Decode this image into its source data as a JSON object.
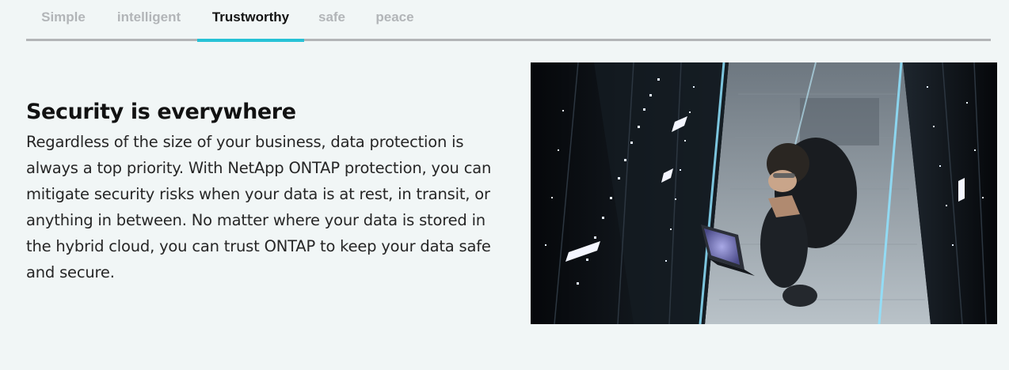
{
  "tabs": [
    {
      "label": "Simple",
      "active": false
    },
    {
      "label": "intelligent",
      "active": false
    },
    {
      "label": "Trustworthy",
      "active": true
    },
    {
      "label": "safe",
      "active": false
    },
    {
      "label": "peace",
      "active": false
    }
  ],
  "colors": {
    "background": "#f1f6f6",
    "active_tab_text": "#121212",
    "inactive_tab_text": "#b2b5b8",
    "tab_indicator": "#27c2d6",
    "tab_underline": "#b3b5b7",
    "body_text": "#262626"
  },
  "content": {
    "title": "Security is everywhere",
    "body": "Regardless of the size of your business, data protection is always a top priority. With NetApp ONTAP protection, you can mitigate security risks when your data is at rest, in transit, or anything in between. No matter where your data is stored in the hybrid cloud, you can trust ONTAP to keep your data safe and secure."
  },
  "image": {
    "subject": "person-with-laptop-in-server-room"
  }
}
